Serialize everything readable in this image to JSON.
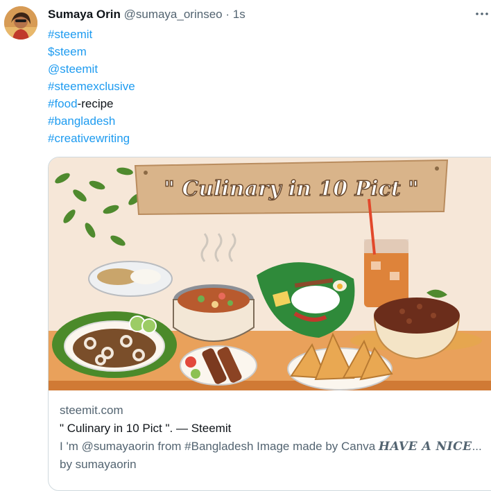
{
  "post": {
    "author_name": "Sumaya Orin",
    "author_handle": "@sumaya_orinseo",
    "separator": "·",
    "timestamp": "1s",
    "lines": [
      [
        {
          "text": "#steemit",
          "tag": true
        }
      ],
      [
        {
          "text": "$steem",
          "tag": true
        }
      ],
      [
        {
          "text": "@steemit",
          "tag": true
        }
      ],
      [
        {
          "text": "#steemexclusive",
          "tag": true
        }
      ],
      [
        {
          "text": "#food",
          "tag": true
        },
        {
          "text": "-recipe",
          "tag": false
        }
      ],
      [
        {
          "text": "#bangladesh",
          "tag": true
        }
      ],
      [
        {
          "text": "#creativewriting",
          "tag": true
        }
      ]
    ]
  },
  "card": {
    "image_title": "\" Culinary in 10 Pict \"",
    "domain": "steemit.com",
    "title": "\" Culinary in 10 Pict \". — Steemit",
    "desc_prefix": "I 'm @sumayaorin from #Bangladesh Image made by Canva ",
    "desc_bold": "HAVE A NICE",
    "desc_suffix": "... by sumayaorin"
  },
  "icons": {
    "avatar": "avatar-photo",
    "more": "more-horizontal-icon"
  },
  "colors": {
    "link": "#1d9bf0",
    "secondary": "#536471",
    "primary": "#0f1419",
    "border": "#cfd9de",
    "image_bg": "#f6e7d8",
    "sign": "#d9b48a"
  }
}
